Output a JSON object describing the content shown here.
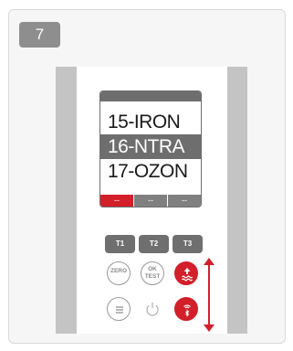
{
  "step": {
    "number": "7"
  },
  "screen": {
    "menu_items": [
      {
        "label": "15-IRON",
        "selected": false
      },
      {
        "label": "16-NTRA",
        "selected": true
      },
      {
        "label": "17-OZON",
        "selected": false
      }
    ],
    "softkeys": [
      {
        "label": "--",
        "active": true
      },
      {
        "label": "--",
        "active": false
      },
      {
        "label": "--",
        "active": false
      }
    ]
  },
  "keys": {
    "t1": "T1",
    "t2": "T2",
    "t3": "T3",
    "zero": "ZERO",
    "ok_test_line1": "OK",
    "ok_test_line2": "TEST"
  },
  "icons": {
    "up_button": "up-arrow-waves-icon",
    "bluetooth_button": "wireless-bluetooth-icon",
    "menu_button": "menu-icon",
    "power_button": "power-icon",
    "scroll_arrow": "double-arrow-vertical-icon"
  },
  "colors": {
    "accent_red": "#d21f2a",
    "display_gray": "#6e6e6e",
    "rail_gray": "#c4c4c4",
    "step_badge_gray": "#8e8e8e"
  }
}
